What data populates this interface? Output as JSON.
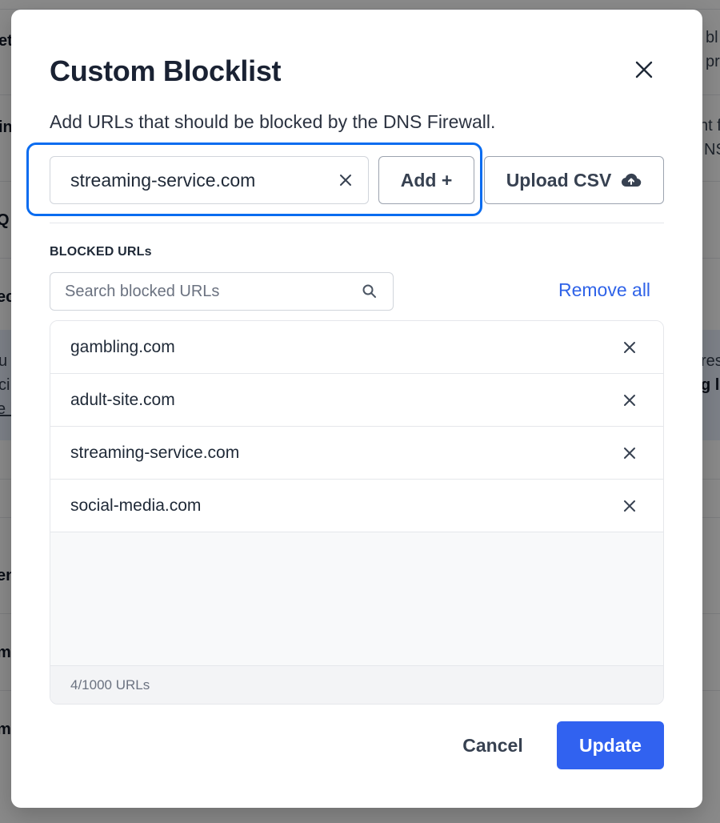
{
  "modal": {
    "title": "Custom Blocklist",
    "description": "Add URLs that should be blocked by the DNS Firewall.",
    "url_input_value": "streaming-service.com",
    "add_label": "Add +",
    "upload_label": "Upload CSV",
    "section_label": "BLOCKED URLs",
    "search_placeholder": "Search blocked URLs",
    "remove_all_label": "Remove all",
    "blocked_urls": [
      "gambling.com",
      "adult-site.com",
      "streaming-service.com",
      "social-media.com"
    ],
    "count_label": "4/1000 URLs",
    "cancel_label": "Cancel",
    "update_label": "Update"
  },
  "background": {
    "left_fragments": [
      "et",
      "in",
      "Q",
      "ec",
      "u",
      "ci",
      "e l",
      "en",
      "m",
      "m"
    ],
    "right_fragments": [
      "bl",
      "pr",
      "nt f",
      "NS",
      "res",
      "g l"
    ]
  },
  "colors": {
    "accent": "#3162f0",
    "focus_ring": "#0a6cf0",
    "link": "#2f63e8"
  },
  "icons": {
    "close": "x-icon",
    "upload": "cloud-upload-icon",
    "search": "magnifier-icon"
  }
}
